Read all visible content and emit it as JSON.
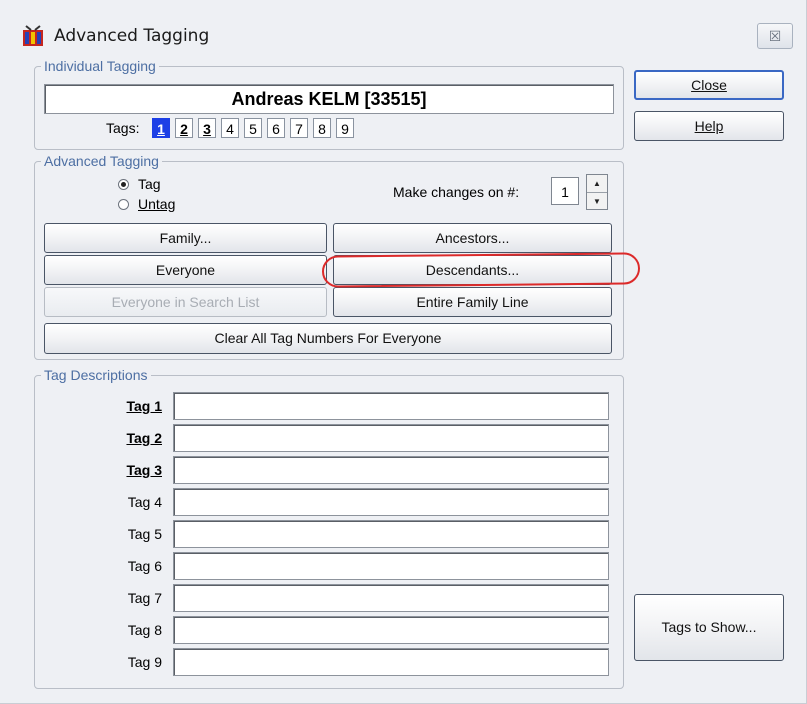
{
  "window": {
    "title": "Advanced Tagging",
    "close_glyph": "☒"
  },
  "individual": {
    "legend": "Individual Tagging",
    "name": "Andreas KELM [33515]",
    "tags_label": "Tags:",
    "tags": [
      "1",
      "2",
      "3",
      "4",
      "5",
      "6",
      "7",
      "8",
      "9"
    ],
    "selected_tag": "1",
    "bold_tags": [
      "1",
      "2",
      "3"
    ]
  },
  "advanced": {
    "legend": "Advanced Tagging",
    "radio_tag": "Tag",
    "radio_untag": "Untag",
    "radio_selected": "Tag",
    "make_changes_label": "Make changes on #:",
    "make_changes_value": "1",
    "buttons": {
      "family": "Family...",
      "ancestors": "Ancestors...",
      "everyone": "Everyone",
      "descendants": "Descendants...",
      "everyone_search": "Everyone in Search List",
      "entire_family_line": "Entire Family Line",
      "clear_all": "Clear All Tag Numbers For Everyone"
    }
  },
  "descriptions": {
    "legend": "Tag Descriptions",
    "rows": [
      {
        "label": "Tag 1",
        "value": ""
      },
      {
        "label": "Tag 2",
        "value": ""
      },
      {
        "label": "Tag 3",
        "value": ""
      },
      {
        "label": "Tag 4",
        "value": ""
      },
      {
        "label": "Tag 5",
        "value": ""
      },
      {
        "label": "Tag 6",
        "value": ""
      },
      {
        "label": "Tag 7",
        "value": ""
      },
      {
        "label": "Tag 8",
        "value": ""
      },
      {
        "label": "Tag 9",
        "value": ""
      }
    ]
  },
  "side_buttons": {
    "close": "Close",
    "help": "Help",
    "tags_to_show": "Tags to Show..."
  },
  "colors": {
    "selected_tag": "#1d3fe6",
    "legend_text": "#4d6fa3",
    "annotation": "#dc2a2a"
  },
  "icons": {
    "app": "family-tree-icon",
    "close": "close-icon",
    "spin_up": "spin-up-icon",
    "spin_down": "spin-down-icon"
  }
}
